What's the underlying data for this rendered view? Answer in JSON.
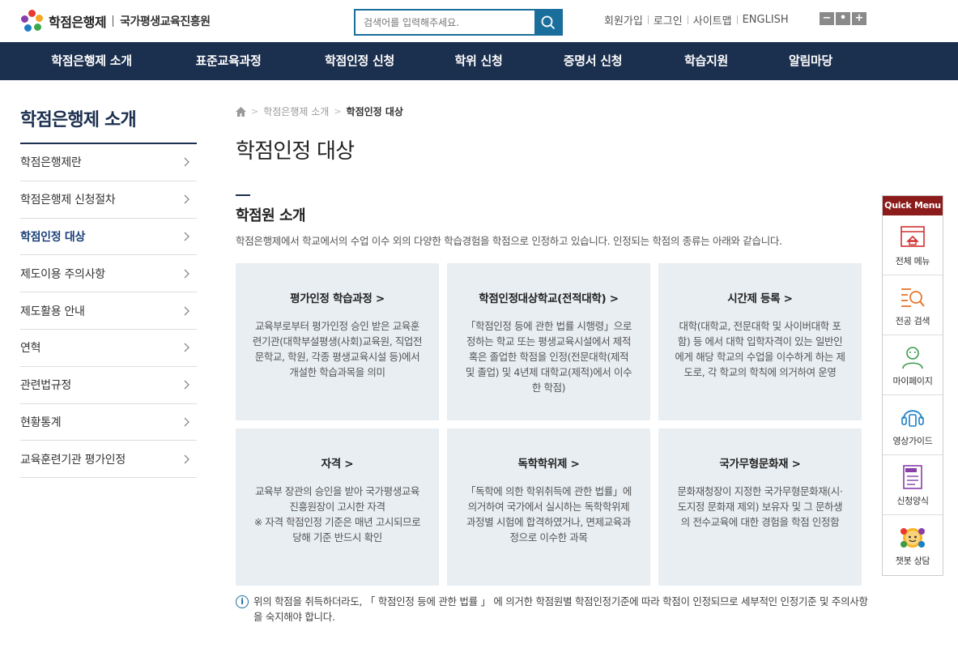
{
  "header": {
    "logo_main": "학점은행제",
    "logo_sub": "국가평생교육진흥원",
    "search_placeholder": "검색어를 입력해주세요.",
    "util": [
      "회원가입",
      "로그인",
      "사이트맵",
      "ENGLISH"
    ],
    "zoom": [
      "−",
      "•",
      "+"
    ]
  },
  "gnb": [
    "학점은행제 소개",
    "표준교육과정",
    "학점인정 신청",
    "학위 신청",
    "증명서 신청",
    "학습지원",
    "알림마당"
  ],
  "sidebar": {
    "title": "학점은행제 소개",
    "items": [
      {
        "label": "학점은행제란",
        "active": false
      },
      {
        "label": "학점은행제 신청절차",
        "active": false
      },
      {
        "label": "학점인정 대상",
        "active": true
      },
      {
        "label": "제도이용 주의사항",
        "active": false
      },
      {
        "label": "제도활용 안내",
        "active": false
      },
      {
        "label": "연혁",
        "active": false
      },
      {
        "label": "관련법규정",
        "active": false
      },
      {
        "label": "현황통계",
        "active": false
      },
      {
        "label": "교육훈련기관 평가인정",
        "active": false
      }
    ]
  },
  "breadcrumb": {
    "level1": "학점은행제 소개",
    "current": "학점인정 대상"
  },
  "page_title": "학점인정 대상",
  "section": {
    "title": "학점원 소개",
    "desc": "학점은행제에서 학교에서의 수업 이수 외의 다양한 학습경험을 학점으로 인정하고 있습니다. 인정되는 학점의 종류는 아래와 같습니다."
  },
  "cards": [
    {
      "title": "평가인정 학습과정 >",
      "body": "교육부로부터 평가인정 승인 받은 교육훈련기관(대학부설평생(사회)교육원, 직업전문학교, 학원, 각종 평생교육시설 등)에서 개설한 학습과목을 의미"
    },
    {
      "title": "학점인정대상학교(전적대학) >",
      "body": "「학점인정 등에 관한 법률 시행령」으로 정하는 학교 또는 평생교육시설에서 제적 혹은 졸업한 학점을 인정(전문대학(제적 및 졸업) 및 4년제 대학교(제적)에서 이수한 학점)"
    },
    {
      "title": "시간제 등록 >",
      "body": "대학(대학교, 전문대학 및 사이버대학 포함) 등 에서 대학 입학자격이 있는 일반인에게 해당 학교의 수업을 이수하게 하는 제도로, 각 학교의 학칙에 의거하여 운영"
    },
    {
      "title": "자격 >",
      "body": "교육부 장관의 승인을 받아 국가평생교육진흥원장이 고시한 자격\n※ 자격 학점인정 기준은 매년 고시되므로 당해 기준 반드시 확인"
    },
    {
      "title": "독학학위제 >",
      "body": "「독학에 의한 학위취득에 관한 법률」에 의거하여 국가에서 실시하는 독학학위제 과정별 시험에 합격하였거나, 면제교육과정으로 이수한 과목"
    },
    {
      "title": "국가무형문화재 >",
      "body": "문화재청장이 지정한 국가무형문화재(시·도지정 문화재 제외) 보유자 및 그 문하생의 전수교육에 대한 경험을 학점 인정함"
    }
  ],
  "notice": "위의 학점을 취득하더라도, 「 학점인정 등에 관한 법률 」 에 의거한 학점원별 학점인정기준에 따라 학점이 인정되므로 세부적인 인정기준 및 주의사항을 숙지해야 합니다.",
  "quick_menu": {
    "title": "Quick Menu",
    "items": [
      {
        "label": "전체 메뉴",
        "icon": "full-menu-icon"
      },
      {
        "label": "전공 검색",
        "icon": "major-search-icon"
      },
      {
        "label": "마이페이지",
        "icon": "mypage-icon"
      },
      {
        "label": "영상가이드",
        "icon": "video-guide-icon"
      },
      {
        "label": "신청양식",
        "icon": "form-icon"
      },
      {
        "label": "챗봇 상담",
        "icon": "chatbot-icon"
      }
    ]
  },
  "colors": {
    "nav": "#1b2f4e",
    "accent": "#1a6e9c",
    "quick_head": "#8c1c1c",
    "card_bg": "#e9eef2"
  }
}
